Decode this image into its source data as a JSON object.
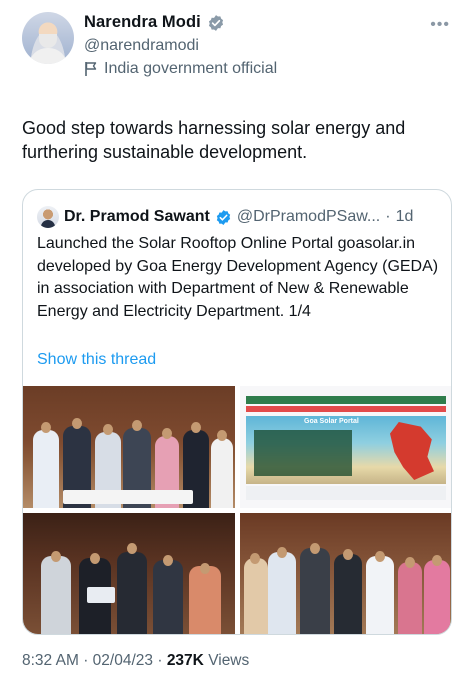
{
  "author": {
    "display_name": "Narendra Modi",
    "handle": "@narendramodi",
    "label": "India government official"
  },
  "tweet": {
    "text": "Good step towards harnessing solar energy and furthering sustainable development."
  },
  "quote": {
    "display_name": "Dr. Pramod Sawant",
    "handle": "@DrPramodPSaw...",
    "separator": "·",
    "time": "1d",
    "text": "Launched the Solar Rooftop Online Portal goasolar.in developed by Goa Energy Development Agency (GEDA) in association with Department of New & Renewable Energy and Electricity Department. 1/4",
    "show_thread": "Show this thread",
    "portal_title": "Goa Solar Portal"
  },
  "meta": {
    "time": "8:32 AM",
    "dot1": "·",
    "date": "02/04/23",
    "dot2": "·",
    "views_count": "237K",
    "views_label": "Views"
  },
  "colors": {
    "link": "#1d9bf0",
    "verified_badge": "#1d9bf0",
    "secondary_text": "#536471"
  },
  "icons": {
    "verified": "verified-badge-icon",
    "government": "flag-icon",
    "more": "more-options-icon"
  }
}
